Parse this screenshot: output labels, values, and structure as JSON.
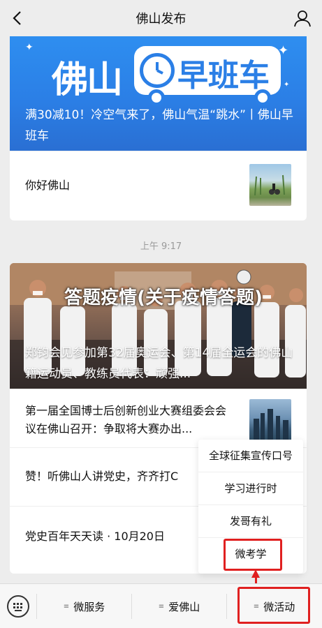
{
  "header": {
    "title": "佛山发布",
    "back_icon": "chevron-left-icon",
    "profile_icon": "user-icon"
  },
  "article1": {
    "banner_logo_left": "佛山",
    "banner_logo_right": "早班车",
    "caption": "满30减10！冷空气来了，佛山气温“跳水”丨佛山早班车",
    "sub_item": "你好佛山"
  },
  "timestamp": "上午 9:17",
  "article2": {
    "overlay_title": "答题疫情(关于疫情答题)",
    "caption": "郑钧会见参加第32届奥运会、第14届全运会的佛山籍运动员、教练员代表：顽强...",
    "items": [
      {
        "text": "第一届全国博士后创新创业大赛组委会会议在佛山召开：争取将大赛办出..."
      },
      {
        "text": "赞！听佛山人讲党史，齐齐打C"
      },
      {
        "text": "党史百年天天读 · 10月20日"
      }
    ]
  },
  "popup_menu": {
    "items": [
      "全球征集宣传口号",
      "学习进行时",
      "发哥有礼",
      "微考学"
    ]
  },
  "bottom_menu": {
    "keyboard_icon": "keyboard-icon",
    "tabs": [
      "微服务",
      "爱佛山",
      "微活动"
    ]
  },
  "colors": {
    "accent_blue": "#2b7fe6",
    "highlight_red": "#e02020",
    "background": "#ededed"
  }
}
